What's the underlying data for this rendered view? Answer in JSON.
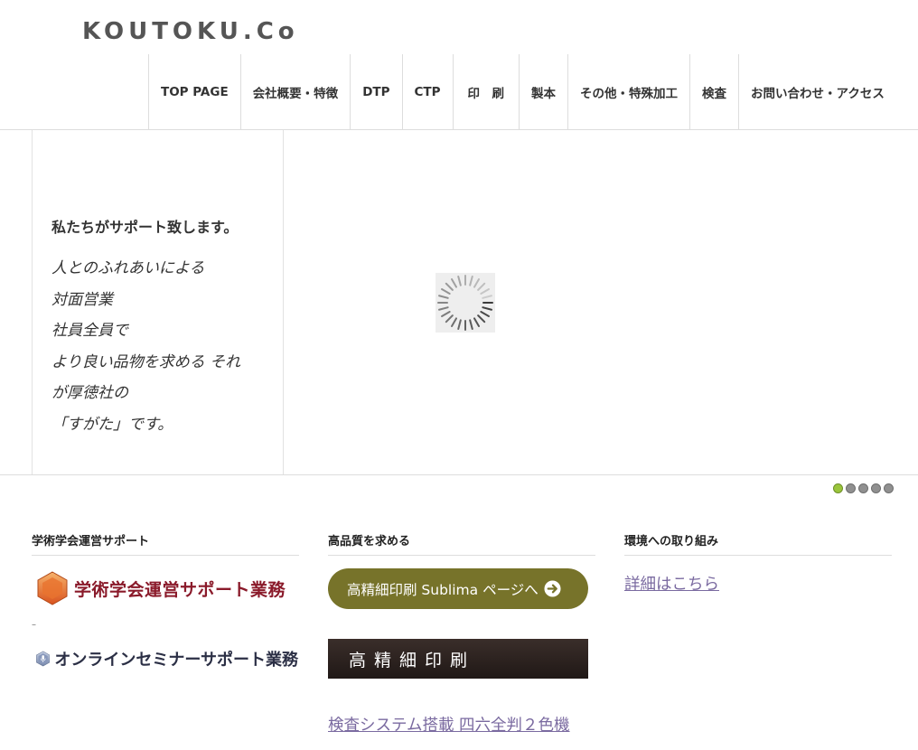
{
  "logo": {
    "text": "KOUTOKU.Co"
  },
  "nav": {
    "items": [
      {
        "label": "TOP PAGE"
      },
      {
        "label": "会社概要・特徴"
      },
      {
        "label": "DTP"
      },
      {
        "label": "CTP"
      },
      {
        "label": "印　刷"
      },
      {
        "label": "製本"
      },
      {
        "label": "その他・特殊加工"
      },
      {
        "label": "検査"
      },
      {
        "label": "お問い合わせ・アクセス"
      }
    ]
  },
  "hero": {
    "title": "私たちがサポート致します。",
    "lines": [
      "人とのふれあいによる",
      "対面営業",
      "社員全員で",
      "より良い品物を求める それ",
      "が厚徳社の",
      "「すがた」です。"
    ]
  },
  "slider": {
    "dot_count": 5,
    "active_index": 0,
    "active_color": "#9ac53b",
    "inactive_color": "#909090"
  },
  "sections": {
    "left": {
      "title": "学術学会運営サポート",
      "banner_a": {
        "text": "学術学会運営サポート業務",
        "icon": "hexagon-icon"
      },
      "dash": "–",
      "banner_b": {
        "text": "オンラインセミナーサポート業務",
        "icon": "microphone-hexagon-icon"
      }
    },
    "middle": {
      "title": "高品質を求める",
      "pill": {
        "text": "高精細印刷 Sublima ページへ",
        "icon": "arrow-circle-icon"
      },
      "dark_banner": {
        "text": "高精細印刷"
      },
      "link": "検査システム搭載 四六全判２色機"
    },
    "right": {
      "title": "環境への取り組み",
      "link": "詳細はこちら"
    }
  },
  "colors": {
    "link": "#7a6aa0",
    "pill_bg": "#77732a",
    "banner_a_text": "#8a1a2a"
  }
}
